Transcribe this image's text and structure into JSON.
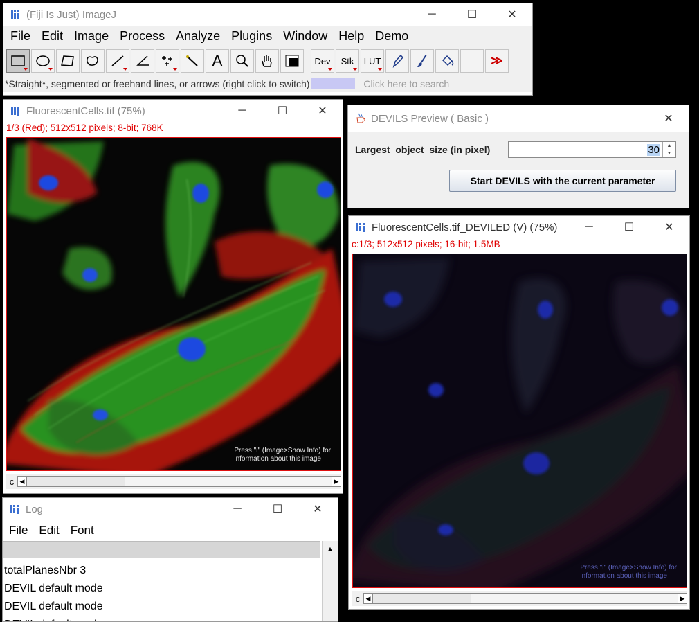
{
  "imagej": {
    "title": "(Fiji Is Just) ImageJ",
    "menus": [
      "File",
      "Edit",
      "Image",
      "Process",
      "Analyze",
      "Plugins",
      "Window",
      "Help",
      "Demo"
    ],
    "tools": [
      "rectangle-tool",
      "oval-tool",
      "polygon-tool",
      "freehand-tool",
      "line-tool",
      "angle-tool",
      "point-tool",
      "wand-tool",
      "text-tool",
      "magnifier-tool",
      "hand-tool",
      "color-picker-tool"
    ],
    "extra_tools": {
      "dev": "Dev",
      "stk": "Stk",
      "lut": "LUT"
    },
    "status": "*Straight*, segmented or freehand lines, or arrows (right click to switch)",
    "search_placeholder": "Click here to search"
  },
  "window_controls": {
    "minimize": "─",
    "maximize": "☐",
    "close": "✕"
  },
  "fluor": {
    "title": "FluorescentCells.tif (75%)",
    "info": "1/3 (Red); 512x512 pixels; 8-bit; 768K",
    "overlay": "Press \"i\" (Image>Show Info) for\ninformation about this image",
    "channel_label": "c"
  },
  "devils_preview": {
    "title": "DEVILS Preview ( Basic )",
    "param_label": "Largest_object_size (in pixel)",
    "param_value": "30",
    "start_button": "Start DEVILS with the current parameter"
  },
  "deviled": {
    "title": "FluorescentCells.tif_DEVILED (V) (75%)",
    "info": "c:1/3; 512x512 pixels; 16-bit; 1.5MB",
    "overlay": "Press \"i\" (Image>Show Info) for\ninformation about this image",
    "channel_label": "c"
  },
  "log": {
    "title": "Log",
    "menus": [
      "File",
      "Edit",
      "Font"
    ],
    "lines": [
      "totalPlanesNbr 3",
      "DEVIL default mode",
      "DEVIL default mode",
      "DEVIL default mode"
    ]
  },
  "colors": {
    "accent_red": "#e00000",
    "fiji_blue": "#3b6fd1"
  }
}
